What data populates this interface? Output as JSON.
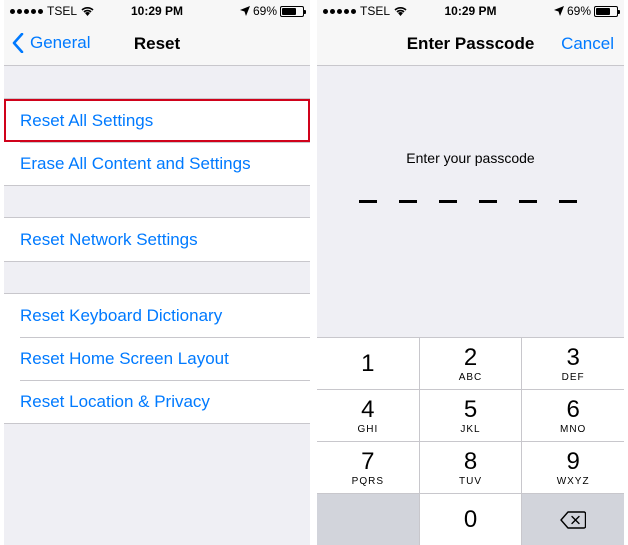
{
  "status_bar": {
    "carrier": "TSEL",
    "time": "10:29 PM",
    "battery": "69%",
    "battery_level": 0.69
  },
  "reset_screen": {
    "back_label": "General",
    "title": "Reset",
    "groups": [
      [
        "Reset All Settings",
        "Erase All Content and Settings"
      ],
      [
        "Reset Network Settings"
      ],
      [
        "Reset Keyboard Dictionary",
        "Reset Home Screen Layout",
        "Reset Location & Privacy"
      ]
    ],
    "highlighted_item": "Reset All Settings",
    "highlight_color": "#d0021b"
  },
  "passcode_screen": {
    "title": "Enter Passcode",
    "cancel_label": "Cancel",
    "prompt": "Enter your passcode",
    "digit_count": 6,
    "keys": [
      {
        "digit": "1",
        "letters": ""
      },
      {
        "digit": "2",
        "letters": "ABC"
      },
      {
        "digit": "3",
        "letters": "DEF"
      },
      {
        "digit": "4",
        "letters": "GHI"
      },
      {
        "digit": "5",
        "letters": "JKL"
      },
      {
        "digit": "6",
        "letters": "MNO"
      },
      {
        "digit": "7",
        "letters": "PQRS"
      },
      {
        "digit": "8",
        "letters": "TUV"
      },
      {
        "digit": "9",
        "letters": "WXYZ"
      },
      {
        "digit": "0",
        "letters": ""
      }
    ],
    "delete_icon": "backspace-icon"
  },
  "colors": {
    "accent": "#007aff",
    "background": "#efeff4",
    "separator": "#c8c7cc"
  }
}
